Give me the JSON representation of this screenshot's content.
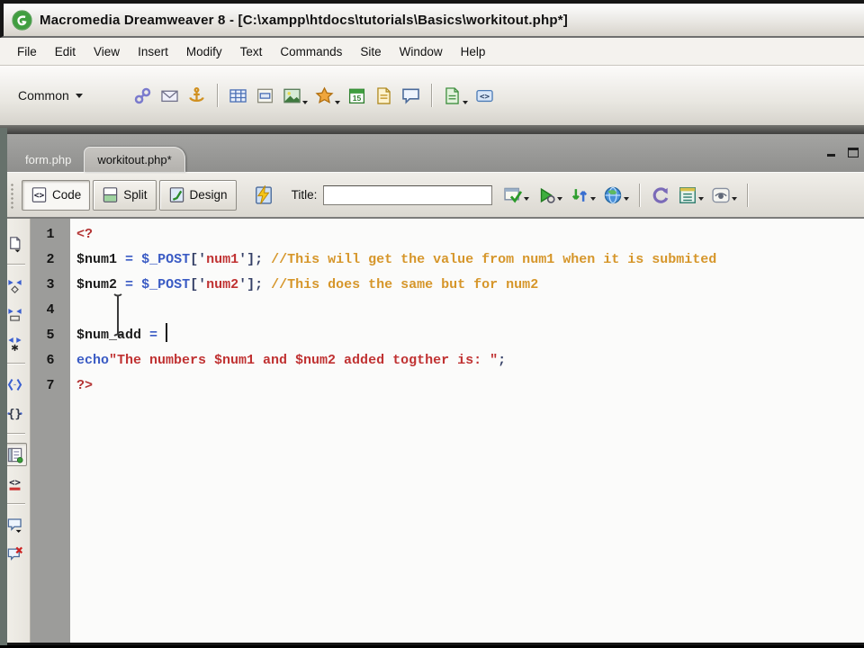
{
  "window": {
    "title": "Macromedia Dreamweaver 8 - [C:\\xampp\\htdocs\\tutorials\\Basics\\workitout.php*]",
    "app_icon": "dreamweaver-logo",
    "buttons": {
      "minimize": "minimize",
      "restore": "restore"
    }
  },
  "menu": {
    "items": [
      "File",
      "Edit",
      "View",
      "Insert",
      "Modify",
      "Text",
      "Commands",
      "Site",
      "Window",
      "Help"
    ]
  },
  "insert_bar": {
    "category": "Common",
    "icons": [
      {
        "name": "hyperlink",
        "dropdown": false,
        "divider_after": false
      },
      {
        "name": "email-link",
        "dropdown": false,
        "divider_after": false
      },
      {
        "name": "named-anchor",
        "dropdown": false,
        "divider_after": true
      },
      {
        "name": "table",
        "dropdown": false,
        "divider_after": false
      },
      {
        "name": "insert-div",
        "dropdown": false,
        "divider_after": false
      },
      {
        "name": "image",
        "dropdown": true,
        "divider_after": false
      },
      {
        "name": "media",
        "dropdown": true,
        "divider_after": false
      },
      {
        "name": "date",
        "dropdown": false,
        "divider_after": false
      },
      {
        "name": "server-include",
        "dropdown": false,
        "divider_after": false
      },
      {
        "name": "comment",
        "dropdown": false,
        "divider_after": true
      },
      {
        "name": "templates",
        "dropdown": true,
        "divider_after": false
      },
      {
        "name": "tag-chooser",
        "dropdown": false,
        "divider_after": false
      }
    ]
  },
  "tabs": [
    {
      "label": "form.php",
      "active": false
    },
    {
      "label": "workitout.php*",
      "active": true
    }
  ],
  "doc_toolbar": {
    "view_buttons": [
      {
        "label": "Code",
        "icon": "code-view",
        "active": true
      },
      {
        "label": "Split",
        "icon": "split-view",
        "active": false
      },
      {
        "label": "Design",
        "icon": "design-view",
        "active": false
      }
    ],
    "live_data_icon": "live-data",
    "title_label": "Title:",
    "title_value": "",
    "right_icons": [
      {
        "name": "browser-check",
        "dropdown": true,
        "divider_after": false
      },
      {
        "name": "preview-debug",
        "dropdown": true,
        "divider_after": false
      },
      {
        "name": "file-management",
        "dropdown": true,
        "divider_after": false
      },
      {
        "name": "preview-browser",
        "dropdown": true,
        "divider_after": true
      },
      {
        "name": "refresh",
        "dropdown": false,
        "divider_after": false
      },
      {
        "name": "view-options",
        "dropdown": true,
        "divider_after": false
      },
      {
        "name": "visual-aids",
        "dropdown": true,
        "divider_after": true
      }
    ]
  },
  "coding_toolbar": {
    "icons": [
      {
        "name": "open-documents",
        "divider_after": true,
        "active": false
      },
      {
        "name": "collapse-full-tag",
        "divider_after": false,
        "active": false
      },
      {
        "name": "collapse-selection",
        "divider_after": false,
        "active": false
      },
      {
        "name": "expand-all",
        "divider_after": true,
        "active": false
      },
      {
        "name": "select-parent-tag",
        "divider_after": false,
        "active": false
      },
      {
        "name": "balance-braces",
        "divider_after": true,
        "active": false
      },
      {
        "name": "line-numbers",
        "divider_after": false,
        "active": true
      },
      {
        "name": "highlight-invalid-code",
        "divider_after": true,
        "active": false
      },
      {
        "name": "apply-comment",
        "divider_after": false,
        "active": false
      },
      {
        "name": "remove-comment",
        "divider_after": false,
        "active": false
      }
    ]
  },
  "code": {
    "lines": [
      {
        "number": 1,
        "tokens": [
          [
            "t",
            "<?"
          ]
        ]
      },
      {
        "number": 2,
        "tokens": [
          [
            "v",
            "$num1"
          ],
          [
            "w",
            " "
          ],
          [
            "o",
            "="
          ],
          [
            "w",
            " "
          ],
          [
            "k",
            "$_POST"
          ],
          [
            "p",
            "['"
          ],
          [
            "s",
            "num1"
          ],
          [
            "p",
            "'];"
          ],
          [
            "w",
            " "
          ],
          [
            "c",
            "//This will get the value from num1 when it is submited"
          ]
        ]
      },
      {
        "number": 3,
        "tokens": [
          [
            "v",
            "$num2"
          ],
          [
            "w",
            " "
          ],
          [
            "o",
            "="
          ],
          [
            "w",
            " "
          ],
          [
            "k",
            "$_POST"
          ],
          [
            "p",
            "['"
          ],
          [
            "s",
            "num2"
          ],
          [
            "p",
            "'];"
          ],
          [
            "w",
            " "
          ],
          [
            "c",
            "//This does the same but for num2"
          ]
        ]
      },
      {
        "number": 4,
        "tokens": []
      },
      {
        "number": 5,
        "tokens": [
          [
            "v",
            "$num_add"
          ],
          [
            "w",
            " "
          ],
          [
            "o",
            "="
          ],
          [
            "w",
            " "
          ]
        ],
        "caret": true
      },
      {
        "number": 6,
        "tokens": [
          [
            "k",
            "echo"
          ],
          [
            "s",
            "\"The numbers $num1 and $num2 added togther is: \""
          ],
          [
            "p",
            ";"
          ]
        ]
      },
      {
        "number": 7,
        "tokens": [
          [
            "t",
            "?>"
          ]
        ]
      }
    ]
  },
  "colors": {
    "php_tag": "#b43434",
    "string": "#c03232",
    "keyword": "#3a5bc4",
    "operator": "#3a5bc4",
    "variable": "#1c1c1c",
    "comment": "#d6962a",
    "punct": "#343f66",
    "gutter_bg": "#9c9c9a",
    "code_bg": "#fbfbfa"
  }
}
